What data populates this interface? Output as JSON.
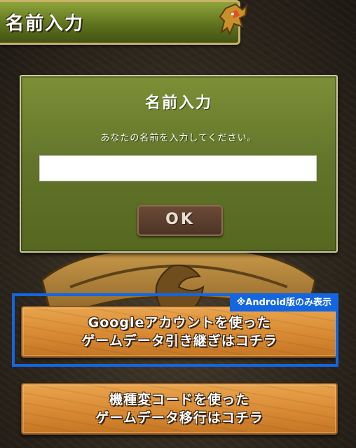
{
  "header": {
    "title": "名前入力"
  },
  "dialog": {
    "title": "名前入力",
    "message": "あなたの名前を入力してください。",
    "name_input": {
      "value": "",
      "placeholder": ""
    },
    "ok_label": "OK"
  },
  "android_notice": "※Android版のみ表示",
  "buttons": {
    "google": {
      "line1": "Googleアカウントを使った",
      "line2": "ゲームデータ引き継ぎはコチラ"
    },
    "model_change": {
      "line1": "機種変コードを使った",
      "line2": "ゲームデータ移行はコチラ"
    }
  },
  "colors": {
    "header_green": "#5b6f1c",
    "dialog_green": "#6a7c2e",
    "ok_brown": "#5a3d2d",
    "wood_orange": "#d88a33",
    "highlight_blue": "#1466e0"
  },
  "icons": [
    "dragon-icon",
    "emblem-icon"
  ]
}
